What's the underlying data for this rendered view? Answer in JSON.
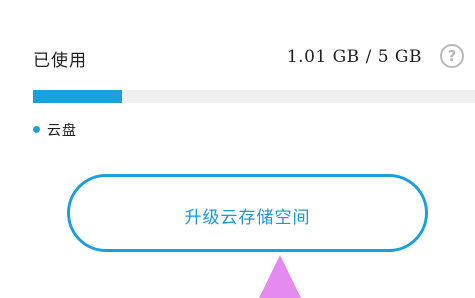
{
  "storage": {
    "used_label": "已使用",
    "used_value": "1.01 GB / 5 GB",
    "help_icon": "question-circle-icon",
    "used_fraction": 0.202,
    "accent_color": "#1aa0dc",
    "track_color": "#f0f0f0"
  },
  "legend": {
    "items": [
      {
        "label": "云盘",
        "color": "#1aa0dc"
      }
    ]
  },
  "actions": {
    "upgrade_label": "升级云存储空间"
  },
  "overlay": {
    "pointer_icon": "pointer-arrow-icon",
    "pointer_color": "#e58af0"
  }
}
